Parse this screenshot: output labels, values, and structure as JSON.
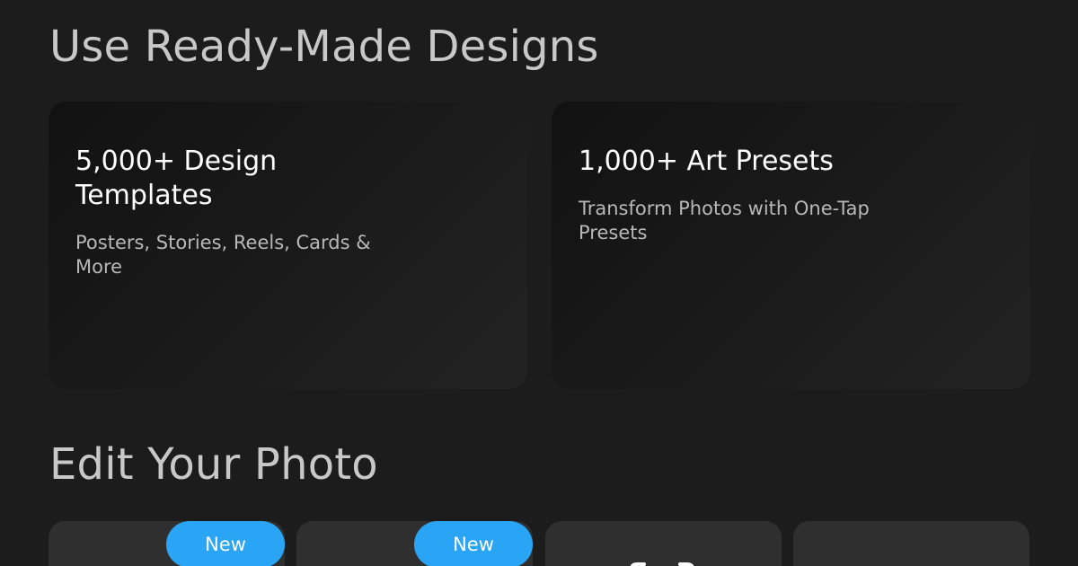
{
  "sections": {
    "ready_made": {
      "title": "Use Ready-Made Designs",
      "cards": [
        {
          "heading": "5,000+ Design Templates",
          "subtitle": "Posters, Stories, Reels, Cards & More"
        },
        {
          "heading": "1,000+ Art Presets",
          "subtitle": "Transform Photos with One-Tap Presets"
        }
      ]
    },
    "edit_photo": {
      "title": "Edit Your Photo",
      "tools": [
        {
          "badge": "New",
          "icon": "tool-icon"
        },
        {
          "badge": "New",
          "icon": "tool-icon"
        },
        {
          "badge": "",
          "icon": "tool-icon"
        },
        {
          "badge": "",
          "icon": "tool-icon"
        }
      ]
    }
  },
  "colors": {
    "background": "#1c1c1c",
    "card_dark": "#121212",
    "tile": "#2f2f2f",
    "badge_blue": "#2aa5f5",
    "title_text": "#c8c8c8",
    "heading_text": "#ffffff",
    "subtitle_text": "#b8b8b8"
  }
}
